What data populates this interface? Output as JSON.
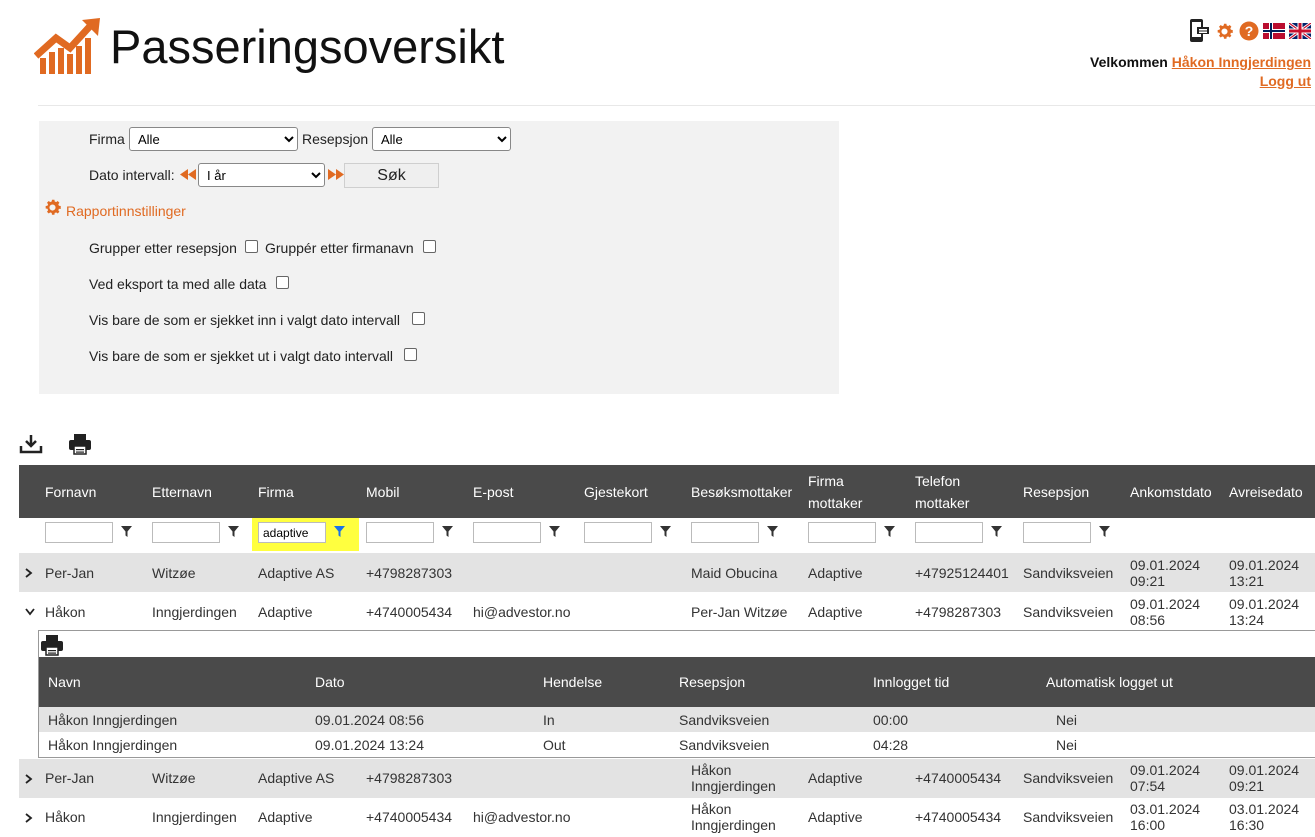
{
  "header": {
    "title": "Passeringsoversikt",
    "welcome_prefix": "Velkommen",
    "user_name": "Håkon Inngjerdingen",
    "logout": "Logg ut"
  },
  "colors": {
    "accent": "#e06a22",
    "grid_header": "#4a4a4a",
    "row_alt": "#e3e3e3",
    "filter_highlight": "#ffff3f"
  },
  "filters": {
    "firma_label": "Firma",
    "firma_value": "Alle",
    "resepsjon_label": "Resepsjon",
    "resepsjon_value": "Alle",
    "date_label": "Dato intervall:",
    "date_value": "I år",
    "search_label": "Søk",
    "settings_link": "Rapportinnstillinger",
    "group_reception": "Grupper etter resepsjon",
    "group_company": "Gruppér etter firmanavn",
    "export_all": "Ved eksport ta med alle data",
    "only_checked_in": "Vis bare de som er sjekket inn i valgt dato intervall",
    "only_checked_out": "Vis bare de som er sjekket ut i valgt dato intervall"
  },
  "grid": {
    "columns": {
      "fornavn": "Fornavn",
      "etternavn": "Etternavn",
      "firma": "Firma",
      "mobil": "Mobil",
      "epost": "E-post",
      "gjestekort": "Gjestekort",
      "besoksmottaker": "Besøksmottaker",
      "firma_mottaker_1": "Firma",
      "firma_mottaker_2": "mottaker",
      "telefon_mottaker_1": "Telefon",
      "telefon_mottaker_2": "mottaker",
      "resepsjon": "Resepsjon",
      "ankomstdato": "Ankomstdato",
      "avreisedato": "Avreisedato"
    },
    "firma_filter_value": "adaptive",
    "rows": [
      {
        "fornavn": "Per-Jan",
        "etternavn": "Witzøe",
        "firma": "Adaptive AS",
        "mobil": "+4798287303",
        "epost": "",
        "besok_1": "Maid Obucina",
        "besok_2": "",
        "firma_mottaker": "Adaptive",
        "telefon_mottaker": "+47925124401",
        "resepsjon": "Sandviksveien",
        "ank_date": "09.01.2024",
        "ank_time": "09:21",
        "avr_date": "09.01.2024",
        "avr_time": "13:21"
      },
      {
        "fornavn": "Håkon",
        "etternavn": "Inngjerdingen",
        "firma": "Adaptive",
        "mobil": "+4740005434",
        "epost": "hi@advestor.no",
        "besok_1": "Per-Jan Witzøe",
        "besok_2": "",
        "firma_mottaker": "Adaptive",
        "telefon_mottaker": "+4798287303",
        "resepsjon": "Sandviksveien",
        "ank_date": "09.01.2024",
        "ank_time": "08:56",
        "avr_date": "09.01.2024",
        "avr_time": "13:24"
      },
      {
        "fornavn": "Per-Jan",
        "etternavn": "Witzøe",
        "firma": "Adaptive AS",
        "mobil": "+4798287303",
        "epost": "",
        "besok_1": "Håkon",
        "besok_2": "Inngjerdingen",
        "firma_mottaker": "Adaptive",
        "telefon_mottaker": "+4740005434",
        "resepsjon": "Sandviksveien",
        "ank_date": "09.01.2024",
        "ank_time": "07:54",
        "avr_date": "09.01.2024",
        "avr_time": "09:21"
      },
      {
        "fornavn": "Håkon",
        "etternavn": "Inngjerdingen",
        "firma": "Adaptive",
        "mobil": "+4740005434",
        "epost": "hi@advestor.no",
        "besok_1": "Håkon",
        "besok_2": "Inngjerdingen",
        "firma_mottaker": "Adaptive",
        "telefon_mottaker": "+4740005434",
        "resepsjon": "Sandviksveien",
        "ank_date": "03.01.2024",
        "ank_time": "16:00",
        "avr_date": "03.01.2024",
        "avr_time": "16:30"
      }
    ]
  },
  "detail": {
    "columns": {
      "navn": "Navn",
      "dato": "Dato",
      "hendelse": "Hendelse",
      "resepsjon": "Resepsjon",
      "innlogget": "Innlogget tid",
      "auto": "Automatisk logget ut"
    },
    "rows": [
      {
        "navn": "Håkon Inngjerdingen",
        "dato": "09.01.2024 08:56",
        "hendelse": "In",
        "resepsjon": "Sandviksveien",
        "innlogget": "00:00",
        "auto": "Nei"
      },
      {
        "navn": "Håkon Inngjerdingen",
        "dato": "09.01.2024 13:24",
        "hendelse": "Out",
        "resepsjon": "Sandviksveien",
        "innlogget": "04:28",
        "auto": "Nei"
      }
    ]
  },
  "icons": [
    "logo-chart-icon",
    "mobile-device-icon",
    "gear-icon",
    "help-icon",
    "norwegian-flag-icon",
    "uk-flag-icon",
    "download-icon",
    "print-icon",
    "filter-icon",
    "chevron-right-icon",
    "chevron-down-icon",
    "rewind-icon",
    "fast-forward-icon"
  ]
}
